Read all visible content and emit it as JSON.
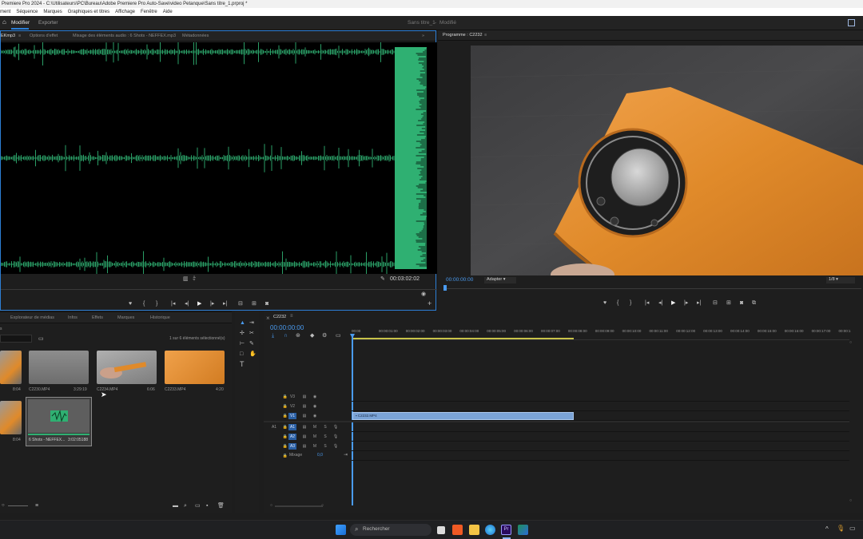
{
  "window": {
    "title": "Premiere Pro 2024 - C:\\Utilisateurs\\PC\\Bureau\\Adobe Premiere Pro Auto-Save\\video Petanque\\Sans titre_1.prproj *"
  },
  "menu": [
    "ment",
    "Séquence",
    "Marques",
    "Graphiques et titres",
    "Affichage",
    "Fenêtre",
    "Aide"
  ],
  "workspace": {
    "tabs": [
      "Modifier",
      "Exporter"
    ],
    "project_name": "Sans titre_1",
    "project_state": "Modifié"
  },
  "source_panel": {
    "tabs": [
      "EKmp3",
      "Options d'effet",
      "Mixage des éléments audio : 6 Shots - NEFFEX.mp3",
      "Métadonnées"
    ],
    "timecode": "00:03:02:02"
  },
  "program_panel": {
    "title": "Programme : C2232",
    "timecode": "00:00:00:00",
    "fit": "Adapter",
    "resolution": "1/8"
  },
  "project_panel": {
    "tabs": [
      "Explorateur de médias",
      "Infos",
      "Effets",
      "Marques",
      "Historique"
    ],
    "selection_info": "1 sur 6 éléments sélectionné(s)",
    "clips": [
      {
        "name": "",
        "duration": "8:04"
      },
      {
        "name": "C2230.MP4",
        "duration": "3:29:19"
      },
      {
        "name": "C2234.MP4",
        "duration": "6:06"
      },
      {
        "name": "C2233.MP4",
        "duration": "4:20"
      },
      {
        "name": "",
        "duration": "8:04"
      },
      {
        "name": "6 Shots - NEFFEX...",
        "duration": "3:02:05188"
      }
    ]
  },
  "timeline": {
    "sequence": "C2232",
    "timecode": "00:00:00:00",
    "ruler": [
      "00:00",
      "00:00:01:00",
      "00:00:02:00",
      "00:00:03:00",
      "00:00:04:00",
      "00:00:05:00",
      "00:00:06:00",
      "00:00:07:00",
      "00:00:08:00",
      "00:00:09:00",
      "00:00:10:00",
      "00:00:11:00",
      "00:00:12:00",
      "00:00:13:00",
      "00:00:14:00",
      "00:00:15:00",
      "00:00:16:00",
      "00:00:17:00",
      "00:00:1"
    ],
    "video_tracks": [
      "V3",
      "V2",
      "V1"
    ],
    "audio_tracks": [
      "A1",
      "A2",
      "A3"
    ],
    "src_label": "A1",
    "mix_label": "Mixage",
    "mix_value": "0,0",
    "clip_name": "C2232.MP4",
    "clip_fraction": 0.37
  },
  "taskbar": {
    "search": "Rechercher"
  },
  "colors": {
    "accent": "#2d7fd6",
    "waveform": "#2fb072",
    "clip": "#7aa3d6",
    "phone": "#e08a2a"
  }
}
